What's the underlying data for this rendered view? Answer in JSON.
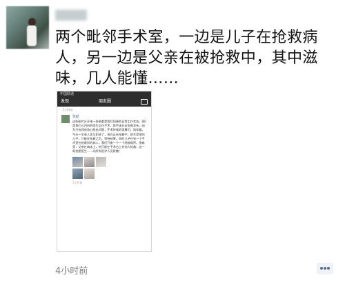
{
  "post": {
    "text": "两个毗邻手术室，一边是儿子在抢救病人，另一边是父亲在被抢救中，其中滋味，几人能懂……",
    "timestamp": "4小时前"
  },
  "screenshot": {
    "status_left": "中国联通",
    "status_time": "",
    "nav_back": "发现",
    "nav_title": "朋友圈",
    "moment_name": "张航",
    "moment_text": "这些图片分开来一张纸都是我们同事的日常工作状态。图1是我们心内科的医生正在手术，我不该在这张图发布，因为只有我爸爸心脏出问题，手术时候的家属们，陪伴着。今天一早老人家又犯病了，现在正在抢救中，医生是他的儿子，只能在抢救之后，等待结果。同时儿子在另一个手术室在抢救别的病人。我们只能一个一个地按顺序。很难受，父亲在病床上，他只能在手术台上为别人抢救，这一刻他是医生……向所有医护人员致敬！",
    "moment_time": "1小时前",
    "top_time": "1小时前"
  },
  "icons": {
    "camera": "camera-icon",
    "comment": "comment-dots-icon"
  }
}
